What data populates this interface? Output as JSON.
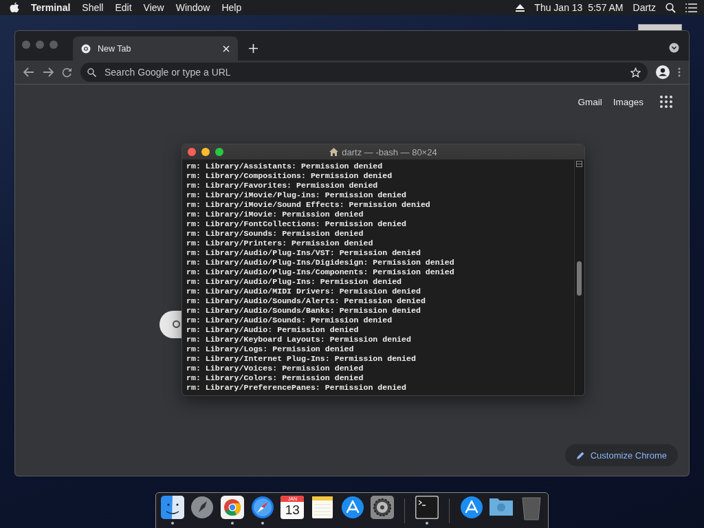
{
  "menu_bar": {
    "app": "Terminal",
    "items": [
      "Shell",
      "Edit",
      "View",
      "Window",
      "Help"
    ],
    "clock": "Thu Jan 13  5:57 AM",
    "user": "Dartz"
  },
  "browser": {
    "tabs": [
      {
        "label": "New Tab",
        "selected": true
      }
    ],
    "address_bar": {
      "placeholder": "Search Google or type a URL"
    },
    "links": [
      "Gmail",
      "Images"
    ],
    "customize_button": "Customize Chrome"
  },
  "terminal": {
    "title": "dartz — -bash — 80×24",
    "lines": [
      "rm: Library/Assistants: Permission denied",
      "rm: Library/Compositions: Permission denied",
      "rm: Library/Favorites: Permission denied",
      "rm: Library/iMovie/Plug-ins: Permission denied",
      "rm: Library/iMovie/Sound Effects: Permission denied",
      "rm: Library/iMovie: Permission denied",
      "rm: Library/FontCollections: Permission denied",
      "rm: Library/Sounds: Permission denied",
      "rm: Library/Printers: Permission denied",
      "rm: Library/Audio/Plug-Ins/VST: Permission denied",
      "rm: Library/Audio/Plug-Ins/Digidesign: Permission denied",
      "rm: Library/Audio/Plug-Ins/Components: Permission denied",
      "rm: Library/Audio/Plug-Ins: Permission denied",
      "rm: Library/Audio/MIDI Drivers: Permission denied",
      "rm: Library/Audio/Sounds/Alerts: Permission denied",
      "rm: Library/Audio/Sounds/Banks: Permission denied",
      "rm: Library/Audio/Sounds: Permission denied",
      "rm: Library/Audio: Permission denied",
      "rm: Library/Keyboard Layouts: Permission denied",
      "rm: Library/Logs: Permission denied",
      "rm: Library/Internet Plug-Ins: Permission denied",
      "rm: Library/Voices: Permission denied",
      "rm: Library/Colors: Permission denied",
      "rm: Library/PreferencePanes: Permission denied"
    ]
  },
  "dock": [
    {
      "kind": "finder",
      "running": true
    },
    {
      "kind": "launchpad",
      "running": false
    },
    {
      "kind": "chrome",
      "running": true
    },
    {
      "kind": "safari",
      "running": true
    },
    {
      "kind": "calendar",
      "running": false,
      "month": "JAN",
      "day": "13"
    },
    {
      "kind": "notes",
      "running": false
    },
    {
      "kind": "appstore",
      "running": false
    },
    {
      "kind": "preferences",
      "running": false
    },
    {
      "kind": "separator"
    },
    {
      "kind": "terminal",
      "running": true
    },
    {
      "kind": "separator"
    },
    {
      "kind": "appstore",
      "running": false
    },
    {
      "kind": "folder",
      "running": false
    },
    {
      "kind": "trash",
      "running": false
    }
  ]
}
